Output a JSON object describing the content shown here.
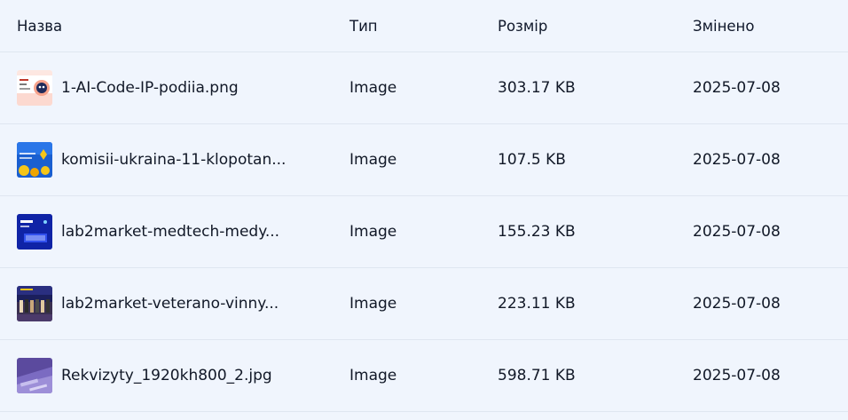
{
  "columns": {
    "name": "Назва",
    "type": "Тип",
    "size": "Розмір",
    "modified": "Змінено"
  },
  "files": [
    {
      "name": "1-AI-Code-IP-podiia.png",
      "type": "Image",
      "size": "303.17 KB",
      "modified": "2025-07-08",
      "thumb": "ai-code-thumbnail"
    },
    {
      "name": "komisii-ukraina-11-klopotan...",
      "type": "Image",
      "size": "107.5 KB",
      "modified": "2025-07-08",
      "thumb": "ukraine-commission-thumbnail"
    },
    {
      "name": "lab2market-medtech-medy...",
      "type": "Image",
      "size": "155.23 KB",
      "modified": "2025-07-08",
      "thumb": "medtech-thumbnail"
    },
    {
      "name": "lab2market-veterano-vinny...",
      "type": "Image",
      "size": "223.11 KB",
      "modified": "2025-07-08",
      "thumb": "veterano-thumbnail"
    },
    {
      "name": "Rekvizyty_1920kh800_2.jpg",
      "type": "Image",
      "size": "598.71 KB",
      "modified": "2025-07-08",
      "thumb": "rekvizyty-thumbnail"
    }
  ]
}
